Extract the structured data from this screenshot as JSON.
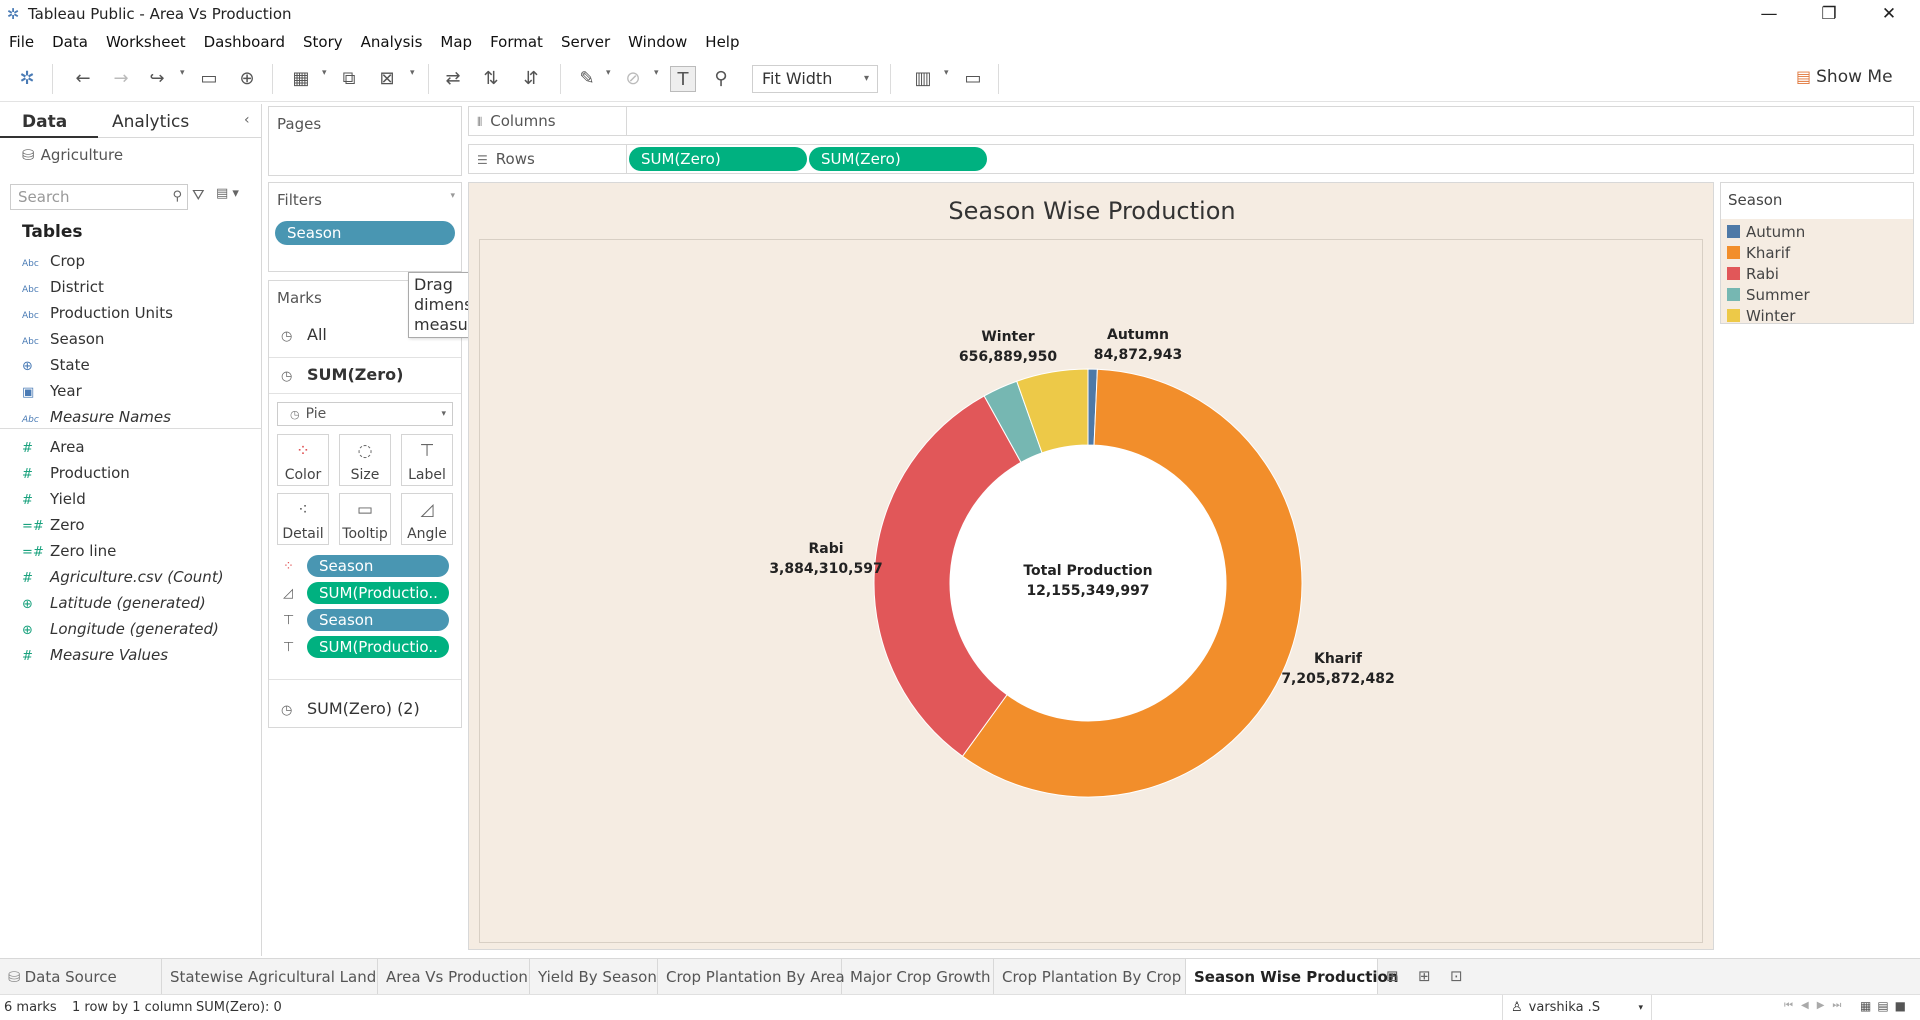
{
  "window": {
    "title": "Tableau Public - Area Vs Production",
    "minimize": "—",
    "restore": "❐",
    "close": "✕"
  },
  "menu": [
    "File",
    "Data",
    "Worksheet",
    "Dashboard",
    "Story",
    "Analysis",
    "Map",
    "Format",
    "Server",
    "Window",
    "Help"
  ],
  "toolbar": {
    "fit_mode": "Fit Width",
    "show_me": "Show Me"
  },
  "data_pane": {
    "tab_data": "Data",
    "tab_analytics": "Analytics",
    "datasource": "Agriculture",
    "search_placeholder": "Search",
    "tables_heading": "Tables",
    "dimensions": [
      {
        "name": "Crop",
        "type": "Abc"
      },
      {
        "name": "District",
        "type": "Abc"
      },
      {
        "name": "Production Units",
        "type": "Abc"
      },
      {
        "name": "Season",
        "type": "Abc"
      },
      {
        "name": "State",
        "type": "globe"
      },
      {
        "name": "Year",
        "type": "calendar"
      },
      {
        "name": "Measure Names",
        "type": "Abc"
      }
    ],
    "measures": [
      {
        "name": "Area"
      },
      {
        "name": "Production"
      },
      {
        "name": "Yield"
      },
      {
        "name": "Zero"
      },
      {
        "name": "Zero line"
      },
      {
        "name": "Agriculture.csv (Count)"
      },
      {
        "name": "Latitude (generated)"
      },
      {
        "name": "Longitude (generated)"
      },
      {
        "name": "Measure Values"
      }
    ]
  },
  "pages": {
    "title": "Pages"
  },
  "filters": {
    "title": "Filters",
    "pill": "Season"
  },
  "drop_hint": "Drag dimensions or measures here.",
  "marks": {
    "title": "Marks",
    "all": "All",
    "layer1": "SUM(Zero)",
    "mark_type": "Pie",
    "buttons": [
      "Color",
      "Size",
      "Label",
      "Detail",
      "Tooltip",
      "Angle"
    ],
    "encodings": [
      {
        "label": "Season",
        "kind": "dim"
      },
      {
        "label": "SUM(Productio..",
        "kind": "meas"
      },
      {
        "label": "Season",
        "kind": "dim"
      },
      {
        "label": "SUM(Productio..",
        "kind": "meas"
      }
    ],
    "layer2": "SUM(Zero) (2)"
  },
  "shelves": {
    "columns_label": "Columns",
    "rows_label": "Rows",
    "rows_pills": [
      "SUM(Zero)",
      "SUM(Zero)"
    ]
  },
  "legend": {
    "title": "Season",
    "items": [
      {
        "name": "Autumn",
        "color": "#4e79a7"
      },
      {
        "name": "Kharif",
        "color": "#f28e2b"
      },
      {
        "name": "Rabi",
        "color": "#e15759"
      },
      {
        "name": "Summer",
        "color": "#76b7b2"
      },
      {
        "name": "Winter",
        "color": "#edc948"
      }
    ]
  },
  "chart_data": {
    "type": "pie",
    "title": "Season Wise Production",
    "center_label": "Total Production",
    "center_value": "12,155,349,997",
    "total": 12155349997,
    "slices": [
      {
        "name": "Autumn",
        "value": 84872943,
        "label": "84,872,943",
        "color": "#4e79a7"
      },
      {
        "name": "Kharif",
        "value": 7205872482,
        "label": "7,205,872,482",
        "color": "#f28e2b"
      },
      {
        "name": "Rabi",
        "value": 3884310597,
        "label": "3,884,310,597",
        "color": "#e15759"
      },
      {
        "name": "Summer",
        "value": 323404025,
        "label": "",
        "color": "#76b7b2"
      },
      {
        "name": "Winter",
        "value": 656889950,
        "label": "656,889,950",
        "color": "#edc948"
      }
    ]
  },
  "sheet_tabs": [
    {
      "label": "Data Source",
      "active": false
    },
    {
      "label": "Statewise Agricultural Land",
      "active": false
    },
    {
      "label": "Area Vs Production",
      "active": false
    },
    {
      "label": "Yield By Season",
      "active": false
    },
    {
      "label": "Crop Plantation By Area",
      "active": false
    },
    {
      "label": "Major Crop Growth",
      "active": false
    },
    {
      "label": "Crop Plantation By Crop",
      "active": false
    },
    {
      "label": "Season Wise Production",
      "active": true
    }
  ],
  "status": {
    "marks": "6 marks",
    "rows": "1 row by 1 column",
    "sum": "SUM(Zero): 0",
    "user": "varshika .S"
  }
}
